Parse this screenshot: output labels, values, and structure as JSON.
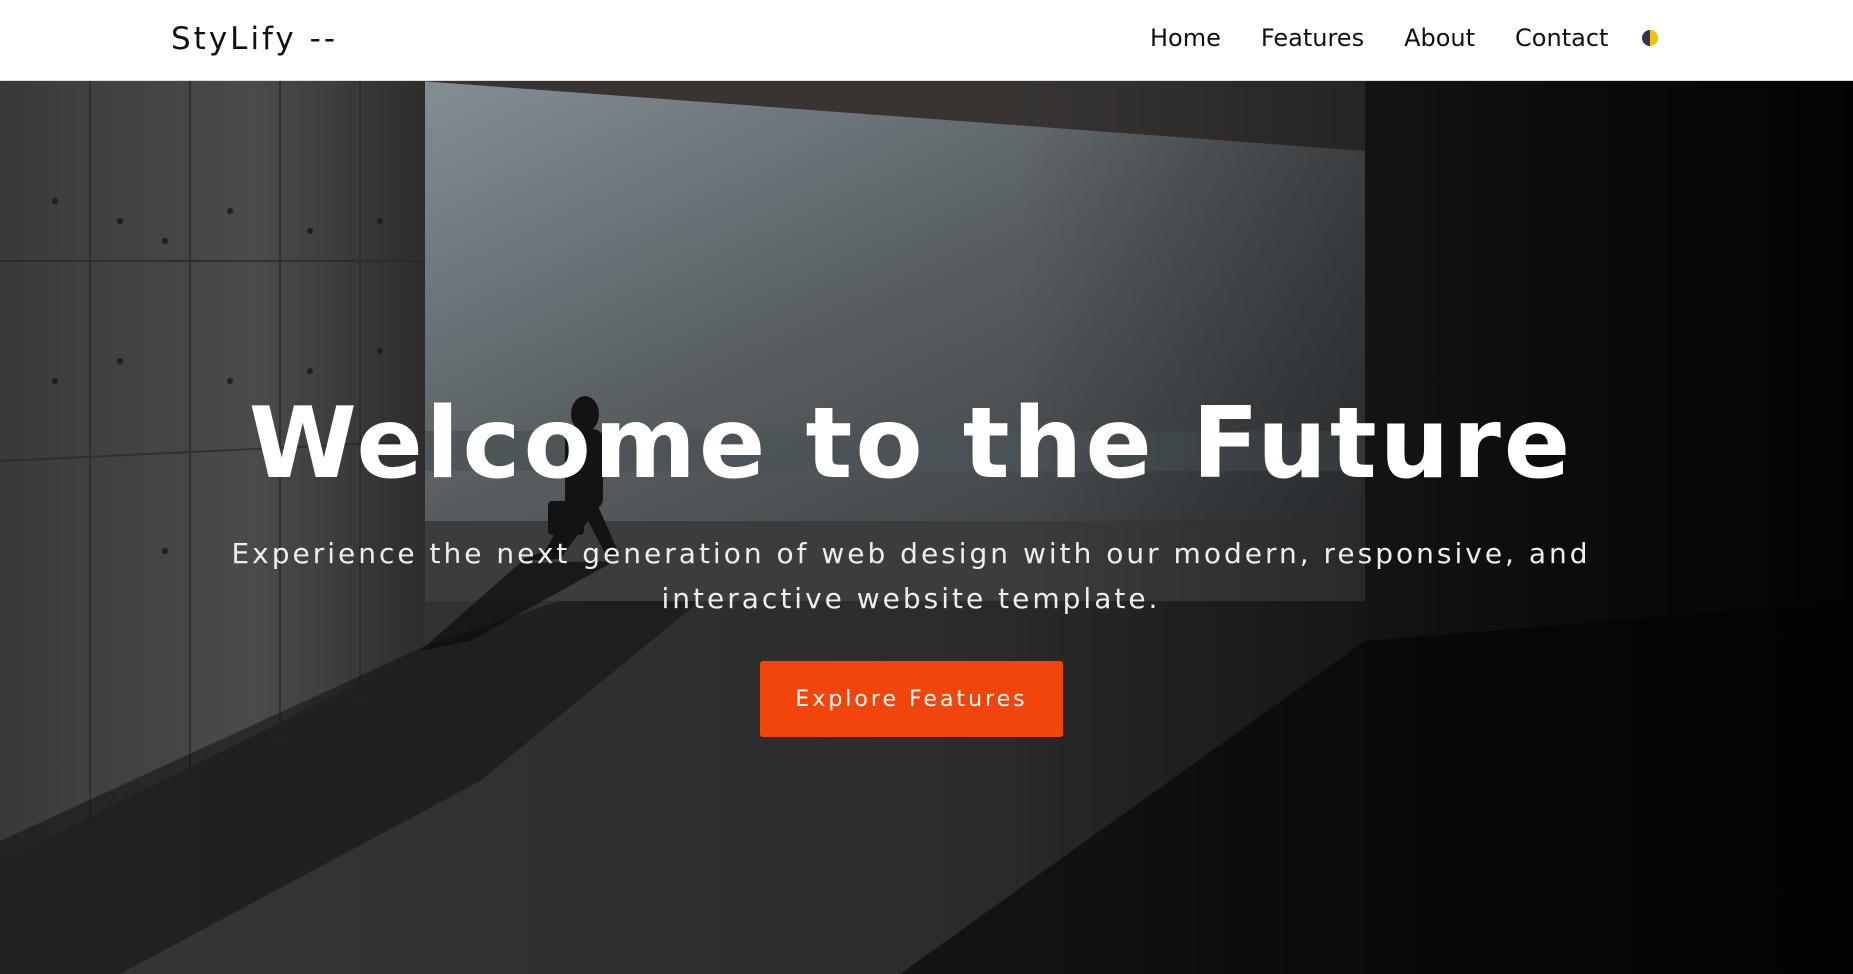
{
  "navbar": {
    "brand": "StyLify --",
    "links": [
      {
        "label": "Home"
      },
      {
        "label": "Features"
      },
      {
        "label": "About"
      },
      {
        "label": "Contact"
      }
    ],
    "theme_toggle_icon": "half-moon-theme-icon",
    "theme_colors": {
      "dark": "#3a2f5a",
      "light": "#f2c200"
    }
  },
  "hero": {
    "title": "Welcome to the Future",
    "subtitle": "Experience the next generation of web design with our modern, responsive, and interactive website template.",
    "cta_label": "Explore Features",
    "accent_color": "#f24509"
  }
}
